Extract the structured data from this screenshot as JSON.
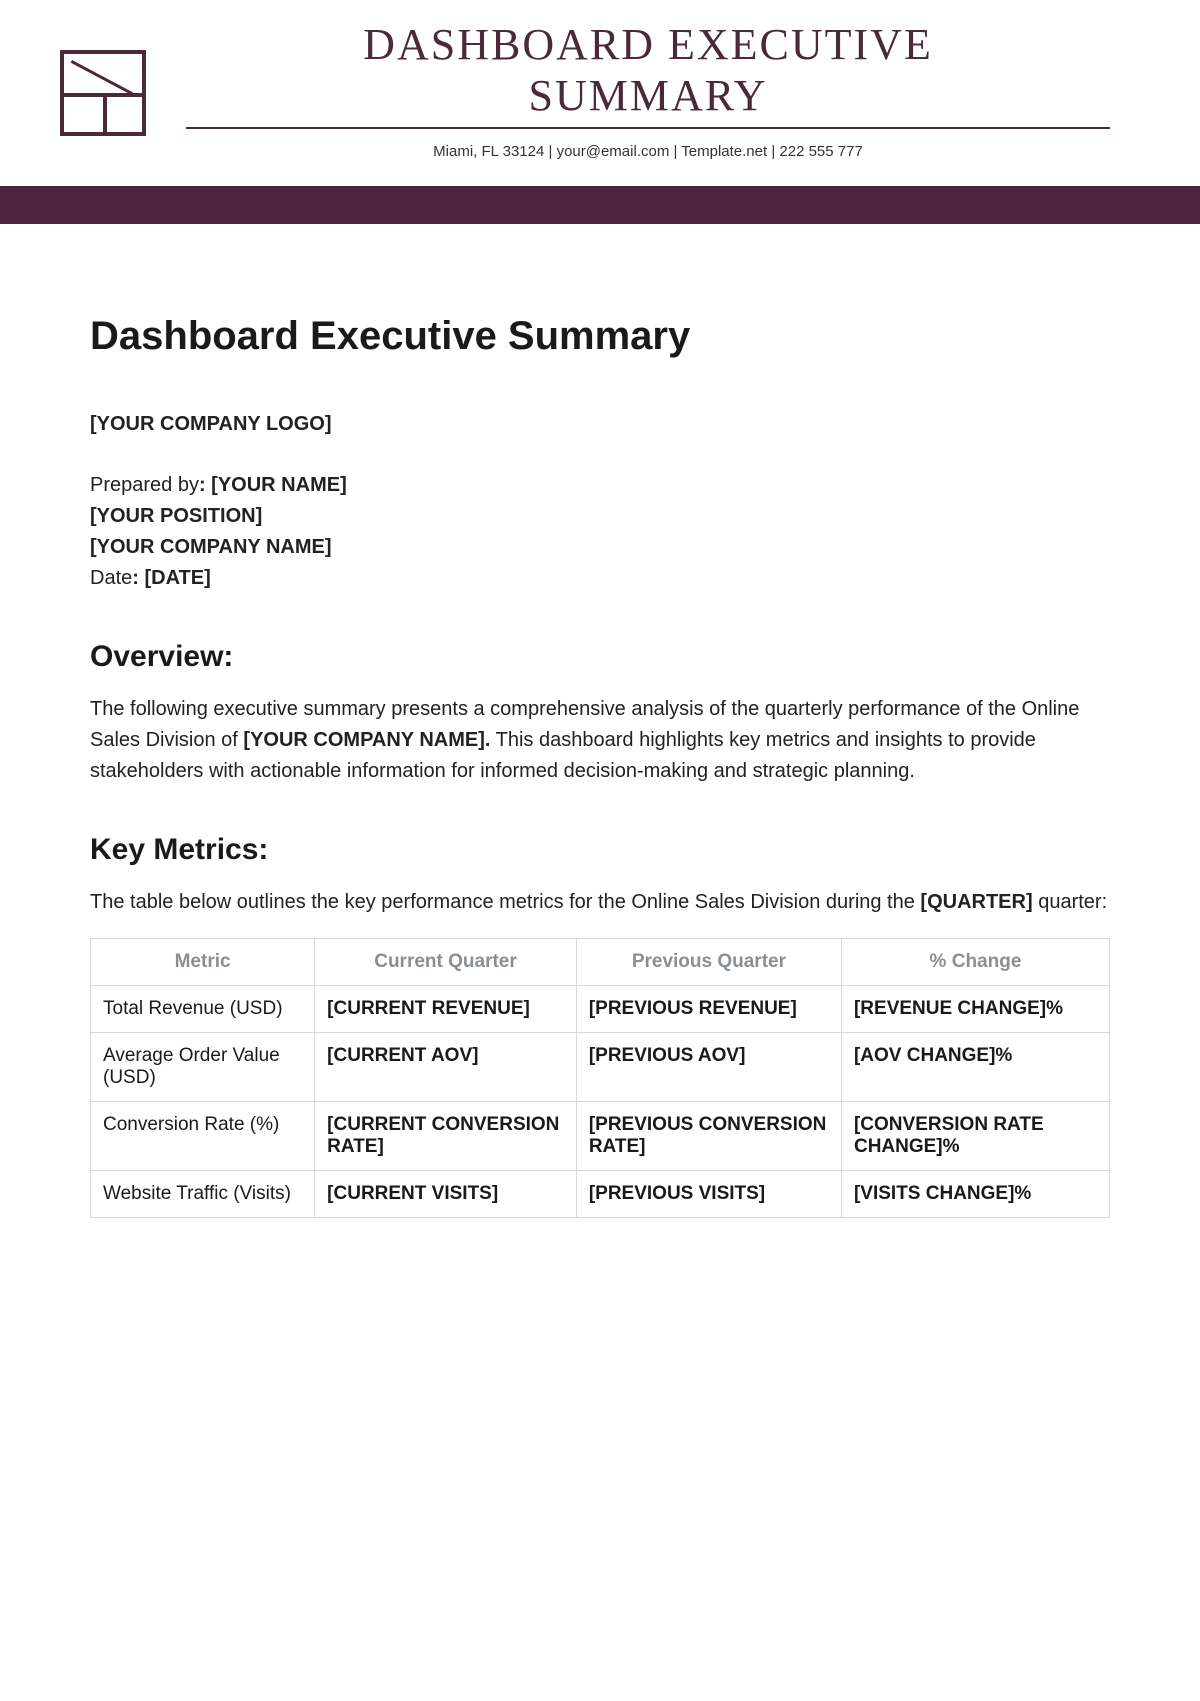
{
  "header": {
    "title_line1": "DASHBOARD EXECUTIVE",
    "title_line2": "SUMMARY",
    "contact": "Miami, FL 33124 | your@email.com | Template.net | 222 555 777"
  },
  "page": {
    "title": "Dashboard Executive Summary",
    "logo_placeholder": "[YOUR COMPANY LOGO]",
    "prepared_by_label": "Prepared by",
    "prepared_by_value": ": [YOUR NAME]",
    "position": "[YOUR POSITION]",
    "company": "[YOUR COMPANY NAME]",
    "date_label": "Date",
    "date_value": ": [DATE]"
  },
  "overview": {
    "heading": "Overview:",
    "text_pre": "The following executive summary presents a comprehensive analysis of the quarterly performance of the Online Sales Division of ",
    "text_bold": "[YOUR COMPANY NAME].",
    "text_post": " This dashboard highlights key metrics and insights to provide stakeholders with actionable information for informed decision-making and strategic planning."
  },
  "key_metrics": {
    "heading": "Key Metrics:",
    "intro_pre": "The table below outlines the key performance metrics for the Online Sales Division during the ",
    "intro_bold": "[QUARTER]",
    "intro_post": " quarter:",
    "columns": [
      "Metric",
      "Current Quarter",
      "Previous Quarter",
      "% Change"
    ],
    "rows": [
      {
        "metric": "Total Revenue (USD)",
        "current": "[CURRENT REVENUE]",
        "previous": "[PREVIOUS REVENUE]",
        "change": "[REVENUE CHANGE]%"
      },
      {
        "metric": "Average Order Value (USD)",
        "current": "[CURRENT AOV]",
        "previous": "[PREVIOUS AOV]",
        "change": "[AOV CHANGE]%"
      },
      {
        "metric": "Conversion Rate (%)",
        "current": "[CURRENT CONVERSION RATE]",
        "previous": "[PREVIOUS CONVERSION RATE]",
        "change": "[CONVERSION RATE CHANGE]%"
      },
      {
        "metric": "Website Traffic (Visits)",
        "current": "[CURRENT VISITS]",
        "previous": "[PREVIOUS VISITS]",
        "change": "[VISITS CHANGE]%"
      }
    ]
  }
}
